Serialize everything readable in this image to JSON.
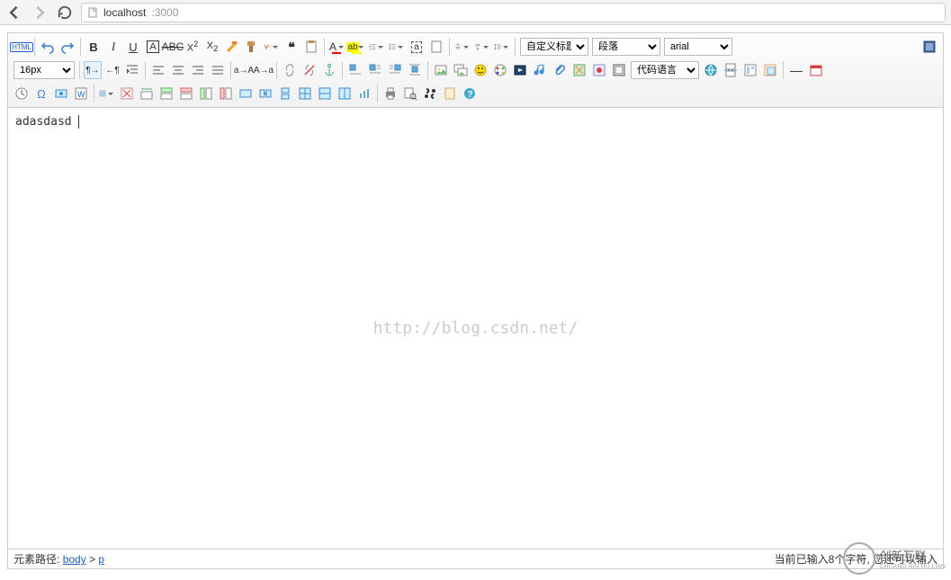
{
  "browser": {
    "url_host": "localhost",
    "url_port": ":3000"
  },
  "toolbar": {
    "html_label": "HTML",
    "font_size": "16px",
    "heading_select": "自定义标题",
    "paragraph_select": "段落",
    "font_family_select": "arial",
    "code_lang_select": "代码语言"
  },
  "editor": {
    "content": "adasdasd",
    "watermark": "http://blog.csdn.net/"
  },
  "status": {
    "path_label": "元素路径:",
    "path_body": "body",
    "path_sep": ">",
    "path_p": "p",
    "char_count": "当前已输入8个字符, 您还可以输入"
  },
  "logo": {
    "brand": "创新互联",
    "sub": "CHUANG XIN HU LIAN"
  }
}
